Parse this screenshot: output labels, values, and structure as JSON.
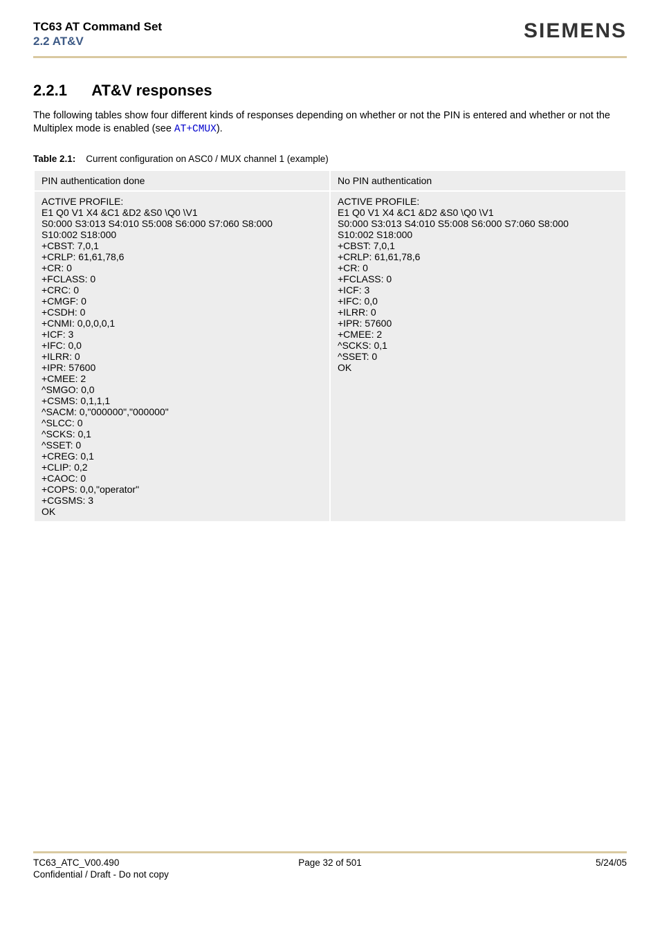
{
  "header": {
    "title": "TC63 AT Command Set",
    "subtitle": "2.2 AT&V",
    "brand": "SIEMENS"
  },
  "section": {
    "number": "2.2.1",
    "title": "AT&V responses",
    "intro_a": "The following tables show four different kinds of responses depending on whether or not the PIN is entered and whether or not the Multiplex mode is enabled (see ",
    "intro_link": "AT+CMUX",
    "intro_b": ")."
  },
  "table": {
    "caption_label": "Table 2.1:",
    "caption_text": "Current configuration on ASC0 / MUX channel 1 (example)",
    "headers": [
      "PIN authentication done",
      "No PIN authentication"
    ],
    "cells": [
      "ACTIVE PROFILE:\nE1 Q0 V1 X4 &C1 &D2 &S0 \\Q0 \\V1\nS0:000 S3:013 S4:010 S5:008 S6:000 S7:060 S8:000\nS10:002 S18:000\n+CBST: 7,0,1\n+CRLP: 61,61,78,6\n+CR: 0\n+FCLASS: 0\n+CRC: 0\n+CMGF: 0\n+CSDH: 0\n+CNMI: 0,0,0,0,1\n+ICF: 3\n+IFC: 0,0\n+ILRR: 0\n+IPR: 57600\n+CMEE: 2\n^SMGO: 0,0\n+CSMS: 0,1,1,1\n^SACM: 0,\"000000\",\"000000\"\n^SLCC: 0\n^SCKS: 0,1\n^SSET: 0\n+CREG: 0,1\n+CLIP: 0,2\n+CAOC: 0\n+COPS: 0,0,\"operator\"\n+CGSMS: 3\nOK",
      "ACTIVE PROFILE:\nE1 Q0 V1 X4 &C1 &D2 &S0 \\Q0 \\V1\nS0:000 S3:013 S4:010 S5:008 S6:000 S7:060 S8:000\nS10:002 S18:000\n+CBST: 7,0,1\n+CRLP: 61,61,78,6\n+CR: 0\n+FCLASS: 0\n+ICF: 3\n+IFC: 0,0\n+ILRR: 0\n+IPR: 57600\n+CMEE: 2\n^SCKS: 0,1\n^SSET: 0\nOK"
    ]
  },
  "footer": {
    "left": "TC63_ATC_V00.490",
    "center": "Page 32 of 501",
    "right": "5/24/05",
    "confidential": "Confidential / Draft - Do not copy"
  }
}
